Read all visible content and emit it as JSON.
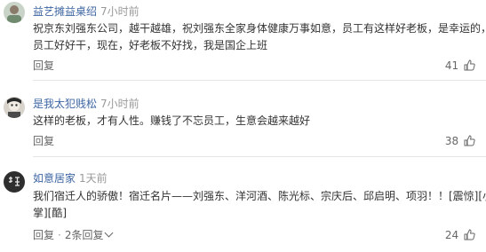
{
  "comments": [
    {
      "username": "益艺摊益桌绍",
      "time": "7小时前",
      "line1": "祝京东刘强东公司，越干越雄，祝刘强东全家身体健康万事如意，员工有这样好老板，是幸运的，京东",
      "line2": "员工好好干，现在，好老板不好找，我是国企上班",
      "reply": "回复",
      "likes": "41"
    },
    {
      "username": "是我太犯贱松",
      "time": "7小时前",
      "line1": "这样的老板，才有人性。赚钱了不忘员工，生意会越来越好",
      "reply": "回复",
      "likes": "38"
    },
    {
      "username": "如意居家",
      "time": "1天前",
      "line1": "我们宿迁人的骄傲！宿迁名片——刘强东、洋河酒、陈光标、宗庆后、邱启明、项羽！！[震惊][小鼓",
      "line2": "掌][酷]",
      "reply": "回复",
      "more_replies": "2条回复",
      "likes": "24"
    }
  ],
  "colors": {
    "username": "#3e66a3",
    "time": "#999999",
    "divider": "#e6e6e6"
  },
  "icons": {
    "like": "thumbs-up-icon",
    "more": "chevron-down-icon"
  }
}
